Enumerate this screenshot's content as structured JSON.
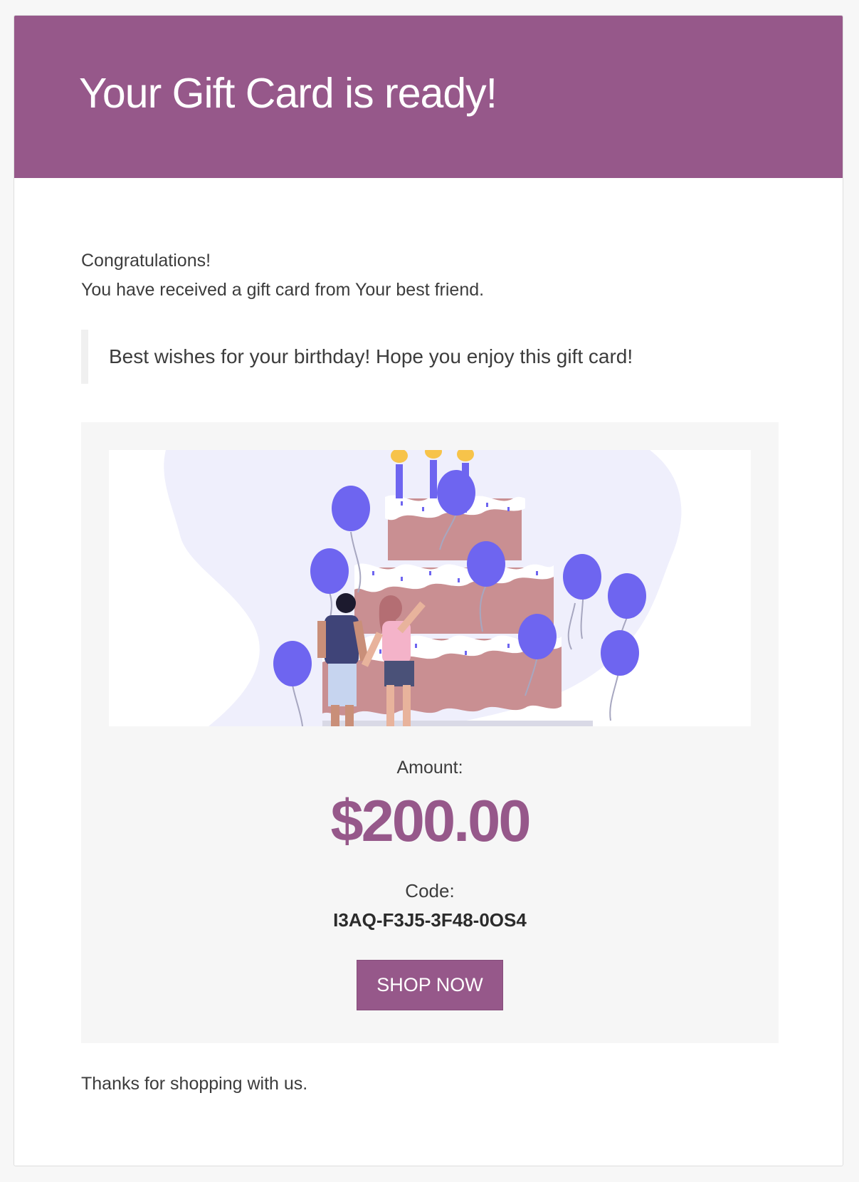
{
  "header": {
    "title": "Your Gift Card is ready!",
    "background_color": "#96588a"
  },
  "message": {
    "greeting": "Congratulations!",
    "received_line": "You have received a gift card from Your best friend.",
    "quote": "Best wishes for your birthday! Hope you enjoy this gift card!"
  },
  "gift_card": {
    "image": "birthday-cake-illustration",
    "amount_label": "Amount:",
    "amount_value": "$200.00",
    "code_label": "Code:",
    "code_value": "I3AQ-F3J5-3F48-0OS4",
    "button_label": "SHOP NOW",
    "accent_color": "#96588a"
  },
  "footer": {
    "thanks": "Thanks for shopping with us."
  }
}
